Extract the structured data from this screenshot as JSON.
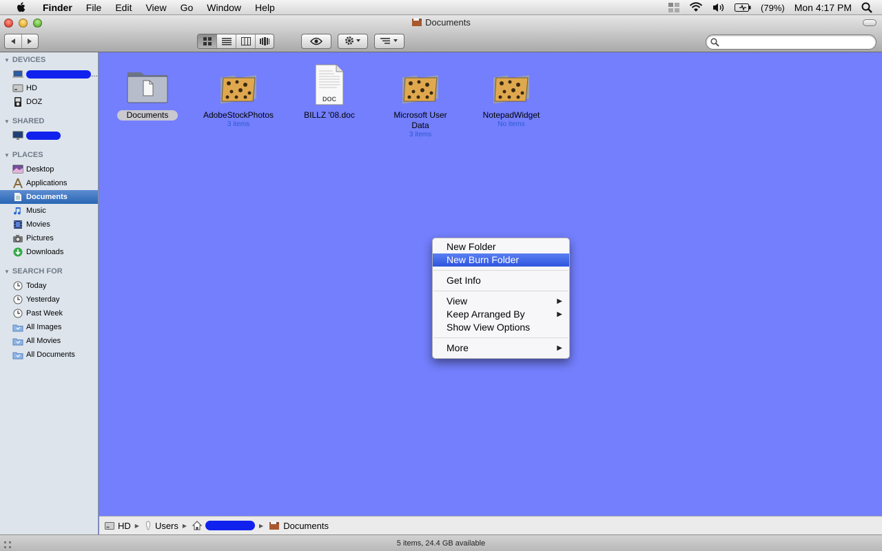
{
  "menubar": {
    "app_name": "Finder",
    "items": [
      "File",
      "Edit",
      "View",
      "Go",
      "Window",
      "Help"
    ],
    "battery": "(79%)",
    "clock": "Mon 4:17 PM"
  },
  "window": {
    "title": "Documents"
  },
  "search": {
    "placeholder": "",
    "value": ""
  },
  "sidebar": {
    "devices_header": "DEVICES",
    "devices": [
      "HD",
      "DOZ"
    ],
    "shared_header": "SHARED",
    "places_header": "PLACES",
    "places": [
      "Desktop",
      "Applications",
      "Documents",
      "Music",
      "Movies",
      "Pictures",
      "Downloads"
    ],
    "search_header": "SEARCH FOR",
    "search_for": [
      "Today",
      "Yesterday",
      "Past Week",
      "All Images",
      "All Movies",
      "All Documents"
    ]
  },
  "files": [
    {
      "name": "Documents",
      "sub": ""
    },
    {
      "name": "AdobeStockPhotos",
      "sub": "3 items"
    },
    {
      "name": "BILLZ '08.doc",
      "sub": "",
      "badge": "DOC"
    },
    {
      "name": "Microsoft User Data",
      "sub": "3 items"
    },
    {
      "name": "NotepadWidget",
      "sub": "No items"
    }
  ],
  "context_menu": {
    "new_folder": "New Folder",
    "new_burn_folder": "New Burn Folder",
    "get_info": "Get Info",
    "view": "View",
    "keep_arranged_by": "Keep Arranged By",
    "show_view_options": "Show View Options",
    "more": "More"
  },
  "pathbar": {
    "segments": [
      "HD",
      "Users",
      "Documents"
    ]
  },
  "status": {
    "text": "5 items, 24.4 GB available"
  },
  "colors": {
    "desktop_background": "#737ffd",
    "selection": "#2866b3",
    "menu_highlight": "#2e55df",
    "redaction": "#1122ee"
  }
}
